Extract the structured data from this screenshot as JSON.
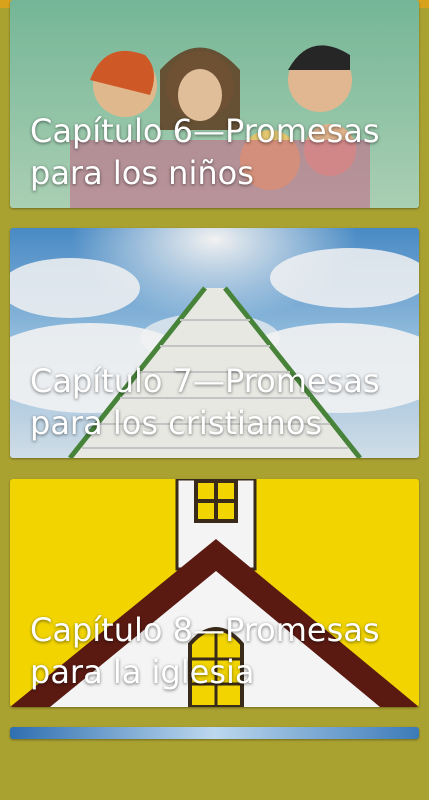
{
  "theme": {
    "background": "#a9a130",
    "status_bar": "#d9a21b"
  },
  "cards": [
    {
      "title_line1": "Capítulo 6—Promesas",
      "title_line2": "para los niños"
    },
    {
      "title_line1": "Capítulo 7—Promesas",
      "title_line2": "para los cristianos"
    },
    {
      "title_line1": "Capítulo 8—Promesas",
      "title_line2": "para la iglesia"
    }
  ]
}
